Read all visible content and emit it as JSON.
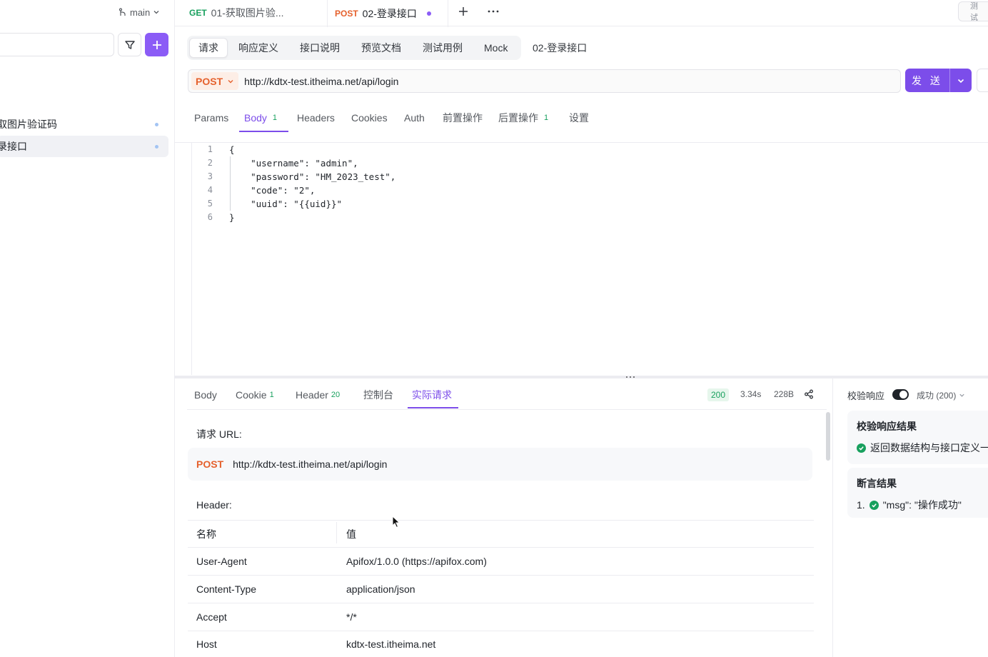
{
  "sidebar": {
    "branch": "main",
    "items": [
      {
        "label": "取图片验证码"
      },
      {
        "label": "录接口"
      }
    ]
  },
  "tabs": [
    {
      "method": "GET",
      "label": "01-获取图片验..."
    },
    {
      "method": "POST",
      "label": "02-登录接口"
    }
  ],
  "top_right_badge": "测 试",
  "subtabs": [
    "请求",
    "响应定义",
    "接口说明",
    "预览文档",
    "测试用例",
    "Mock"
  ],
  "api_name": "02-登录接口",
  "request": {
    "method": "POST",
    "url": "http://kdtx-test.itheima.net/api/login",
    "send_label": "发 送"
  },
  "param_tabs": [
    {
      "label": "Params",
      "count": ""
    },
    {
      "label": "Body",
      "count": "1"
    },
    {
      "label": "Headers",
      "count": ""
    },
    {
      "label": "Cookies",
      "count": ""
    },
    {
      "label": "Auth",
      "count": ""
    },
    {
      "label": "前置操作",
      "count": ""
    },
    {
      "label": "后置操作",
      "count": "1"
    },
    {
      "label": "设置",
      "count": ""
    }
  ],
  "body_code": [
    {
      "n": "1",
      "text": "{"
    },
    {
      "n": "2",
      "text": "    \"username\": \"admin\","
    },
    {
      "n": "3",
      "text": "    \"password\": \"HM_2023_test\","
    },
    {
      "n": "4",
      "text": "    \"code\": \"2\","
    },
    {
      "n": "5",
      "text": "    \"uuid\": \"{{uid}}\""
    },
    {
      "n": "6",
      "text": "}"
    }
  ],
  "response_tabs": [
    {
      "label": "Body",
      "count": ""
    },
    {
      "label": "Cookie",
      "count": "1"
    },
    {
      "label": "Header",
      "count": "20"
    },
    {
      "label": "控制台",
      "count": ""
    },
    {
      "label": "实际请求",
      "count": ""
    }
  ],
  "response_meta": {
    "status": "200",
    "time": "3.34s",
    "size": "228B"
  },
  "actual_request": {
    "url_label": "请求 URL:",
    "method": "POST",
    "url": "http://kdtx-test.itheima.net/api/login",
    "header_label": "Header:",
    "columns": [
      "名称",
      "值"
    ],
    "headers": [
      {
        "name": "User-Agent",
        "value": "Apifox/1.0.0 (https://apifox.com)"
      },
      {
        "name": "Content-Type",
        "value": "application/json"
      },
      {
        "name": "Accept",
        "value": "*/*"
      },
      {
        "name": "Host",
        "value": "kdtx-test.itheima.net"
      }
    ]
  },
  "validation": {
    "title": "校验响应",
    "status_option": "成功 (200)",
    "result_title": "校验响应结果",
    "result_text": "返回数据结构与接口定义一",
    "assert_title": "断言结果",
    "assert_index": "1.",
    "assert_text": "\"msg\": \"操作成功\""
  },
  "colors": {
    "accent": "#7c4dea",
    "post": "#e5612d",
    "get": "#18a05e",
    "success": "#18a05e"
  }
}
